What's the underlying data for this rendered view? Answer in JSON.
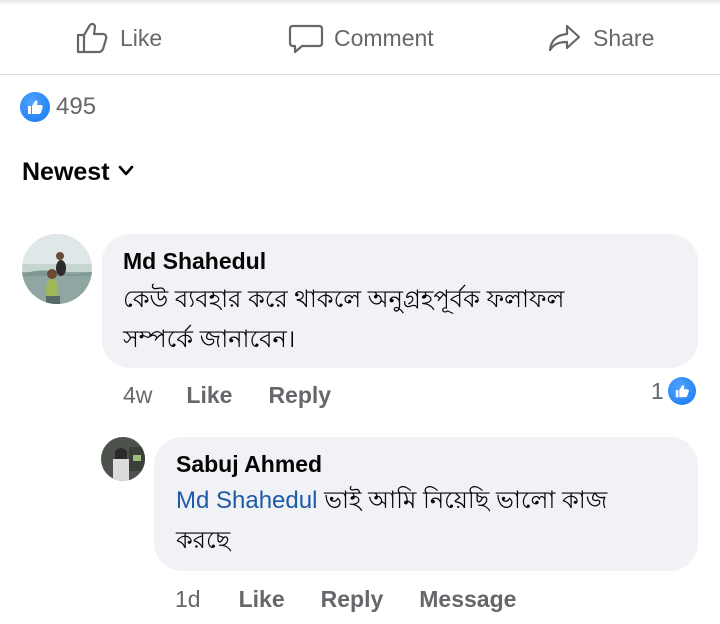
{
  "actions": {
    "like_label": "Like",
    "comment_label": "Comment",
    "share_label": "Share"
  },
  "reactions": {
    "icon": "like-icon",
    "count": "495"
  },
  "sort": {
    "label": "Newest",
    "icon": "chevron-down-icon"
  },
  "comments": [
    {
      "author": "Md Shahedul",
      "text_line1": "কেউ ব্যবহার করে থাকলে অনুগ্রহপূর্বক  ফলাফল",
      "text_line2": "সম্পর্কে জানাবেন।",
      "time": "4w",
      "like_label": "Like",
      "reply_label": "Reply",
      "reaction_count": "1"
    }
  ],
  "replies": [
    {
      "author": "Sabuj Ahmed",
      "mention": "Md Shahedul",
      "text_line1_rest": " ভাই আমি নিয়েছি ভালো কাজ",
      "text_line2": "করছে",
      "time": "1d",
      "like_label": "Like",
      "reply_label": "Reply",
      "message_label": "Message"
    }
  ],
  "colors": {
    "accent": "#1877f2",
    "bubble": "#f0f2f5",
    "secondary_text": "#65676b",
    "mention": "#1d5aa8"
  }
}
